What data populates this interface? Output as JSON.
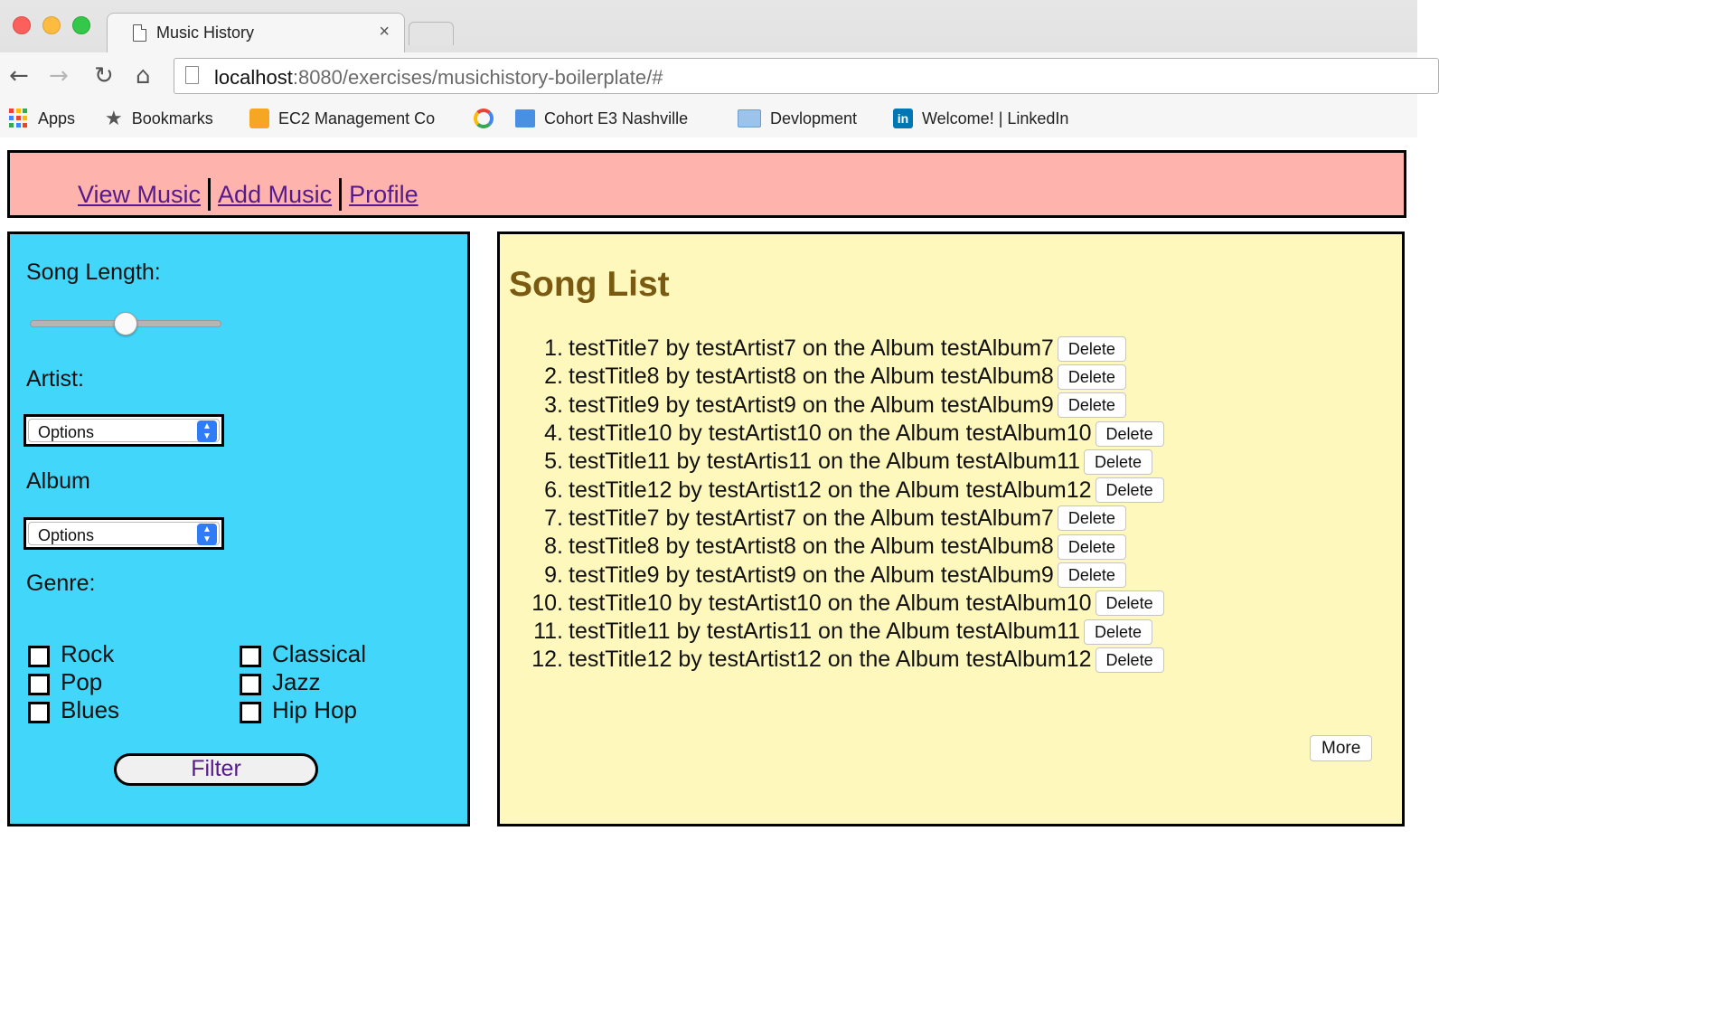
{
  "browser": {
    "tab_title": "Music History",
    "tab_close": "×",
    "url_host": "localhost",
    "url_rest": ":8080/exercises/musichistory-boilerplate/#",
    "nav_icons": {
      "back": "←",
      "forward": "→",
      "reload": "↻",
      "home": "⌂"
    },
    "bookmarks": [
      {
        "label": "Apps",
        "icon": "apps-grid-icon"
      },
      {
        "label": "Bookmarks",
        "icon": "star-icon"
      },
      {
        "label": "EC2 Management Co",
        "icon": "aws-cube-icon"
      },
      {
        "label": "",
        "icon": "google-icon"
      },
      {
        "label": "Cohort E3 Nashville",
        "icon": "classroom-icon"
      },
      {
        "label": "Devlopment",
        "icon": "folder-icon"
      },
      {
        "label": "Welcome! | LinkedIn",
        "icon": "linkedin-icon"
      }
    ],
    "linkedin_glyph": "in"
  },
  "nav": {
    "links": [
      "View Music",
      "Add Music",
      "Profile"
    ]
  },
  "sidebar": {
    "song_length_label": "Song Length:",
    "slider_value_fraction": 0.5,
    "artist_label": "Artist:",
    "artist_select": "Options",
    "album_label": "Album",
    "album_select": "Options",
    "genre_label": "Genre:",
    "genres": [
      "Rock",
      "Classical",
      "Pop",
      "Jazz",
      "Blues",
      "Hip Hop"
    ],
    "filter_label": "Filter"
  },
  "main": {
    "title": "Song List",
    "delete_label": "Delete",
    "more_label": "More",
    "songs": [
      {
        "num": "1.",
        "text": "testTitle7 by testArtist7 on the Album testAlbum7"
      },
      {
        "num": "2.",
        "text": "testTitle8 by testArtist8 on the Album testAlbum8"
      },
      {
        "num": "3.",
        "text": "testTitle9 by testArtist9 on the Album testAlbum9"
      },
      {
        "num": "4.",
        "text": "testTitle10 by testArtist10 on the Album testAlbum10"
      },
      {
        "num": "5.",
        "text": "testTitle11 by testArtis11 on the Album testAlbum11"
      },
      {
        "num": "6.",
        "text": "testTitle12 by testArtist12 on the Album testAlbum12"
      },
      {
        "num": "7.",
        "text": "testTitle7 by testArtist7 on the Album testAlbum7"
      },
      {
        "num": "8.",
        "text": "testTitle8 by testArtist8 on the Album testAlbum8"
      },
      {
        "num": "9.",
        "text": "testTitle9 by testArtist9 on the Album testAlbum9"
      },
      {
        "num": "10.",
        "text": "testTitle10 by testArtist10 on the Album testAlbum10"
      },
      {
        "num": "11.",
        "text": "testTitle11 by testArtis11 on the Album testAlbum11"
      },
      {
        "num": "12.",
        "text": "testTitle12 by testArtist12 on the Album testAlbum12"
      }
    ]
  }
}
